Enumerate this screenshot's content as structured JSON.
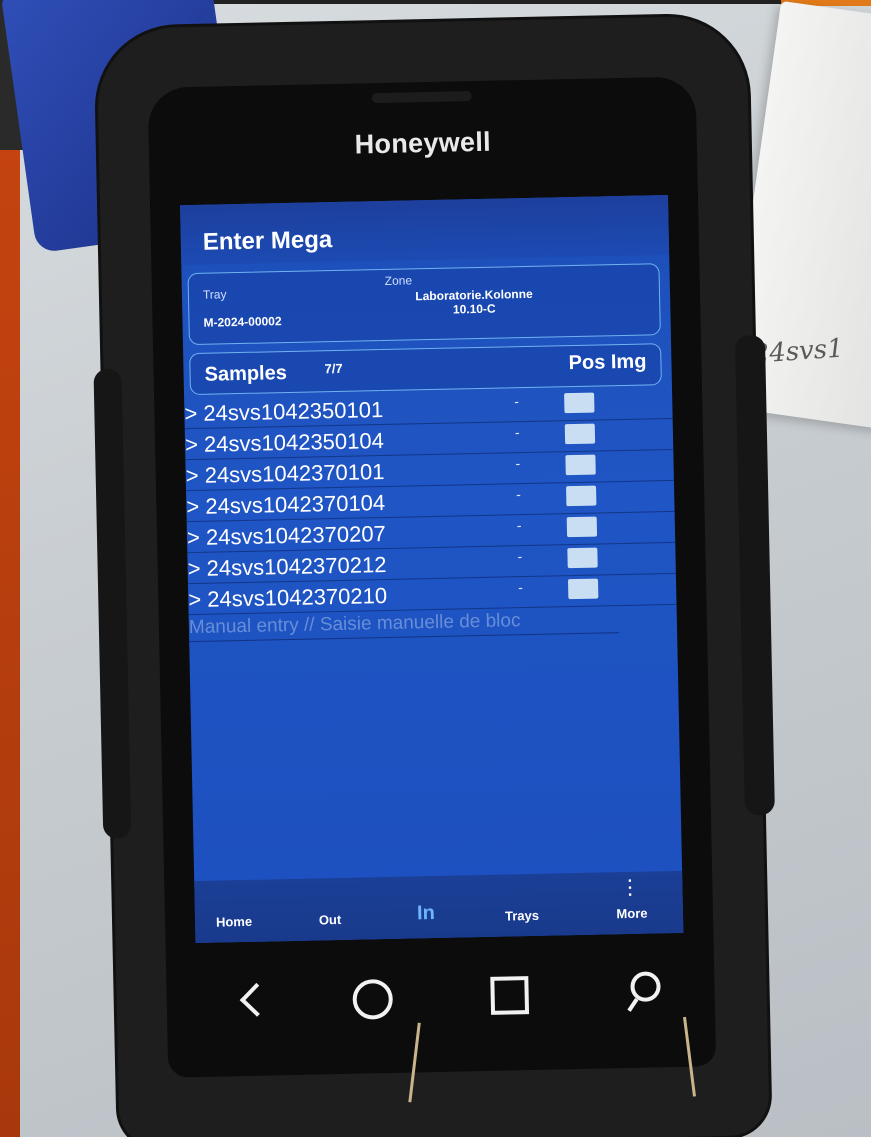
{
  "device": {
    "brand": "Honeywell"
  },
  "app": {
    "title": "Enter Mega"
  },
  "tray": {
    "label": "Tray",
    "value": "M-2024-00002"
  },
  "zone": {
    "label": "Zone",
    "value_line1": "Laboratorie.Kolonne",
    "value_line2": "10.10-C"
  },
  "samples": {
    "title": "Samples",
    "count": "7/7",
    "pos_img_label": "Pos Img",
    "items": [
      {
        "id": "> 24svs1042350101",
        "pos": "-"
      },
      {
        "id": "> 24svs1042350104",
        "pos": "-"
      },
      {
        "id": "> 24svs1042370101",
        "pos": "-"
      },
      {
        "id": "> 24svs1042370104",
        "pos": "-"
      },
      {
        "id": "> 24svs1042370207",
        "pos": "-"
      },
      {
        "id": "> 24svs1042370212",
        "pos": "-"
      },
      {
        "id": "> 24svs1042370210",
        "pos": "-"
      }
    ]
  },
  "manual_entry": {
    "placeholder": "Manual entry // Saisie manuelle de bloc"
  },
  "bottom_nav": {
    "items": [
      {
        "label": "Home"
      },
      {
        "label": "Out"
      },
      {
        "label": "In",
        "active": true
      },
      {
        "label": "Trays"
      },
      {
        "label": "More"
      }
    ]
  },
  "system_nav": {
    "icons": [
      "back-icon",
      "home-circle-icon",
      "recents-square-icon",
      "search-icon"
    ]
  },
  "background": {
    "box_label": "24svs1"
  },
  "colors": {
    "screen_bg": "#1f55c4",
    "card_border": "#6fb2f0",
    "active_nav": "#6db6ff",
    "image_thumb": "#c9def2"
  }
}
